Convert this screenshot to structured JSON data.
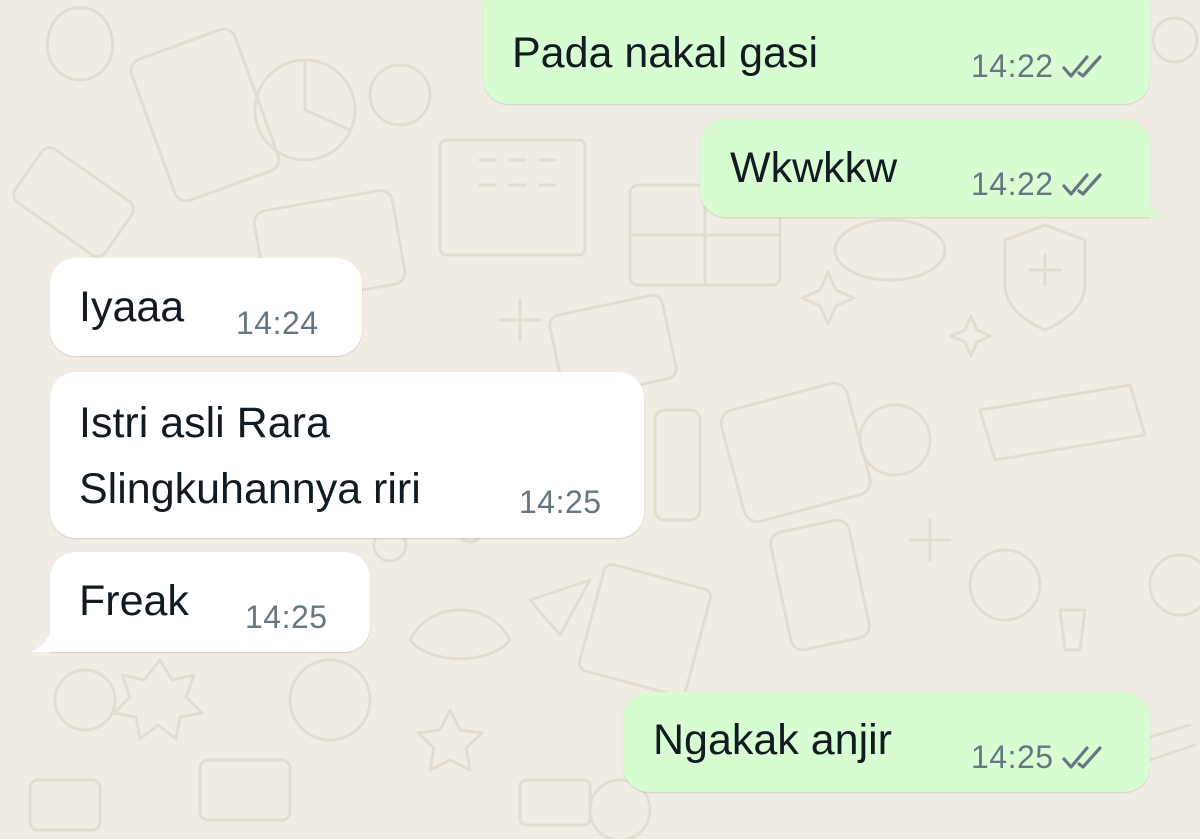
{
  "messages": [
    {
      "direction": "outgoing",
      "text": "Pada nakal gasi",
      "time": "14:22",
      "status": "read"
    },
    {
      "direction": "outgoing",
      "text": "Wkwkkw",
      "time": "14:22",
      "status": "read"
    },
    {
      "direction": "incoming",
      "text": "Iyaaa",
      "time": "14:24"
    },
    {
      "direction": "incoming",
      "lines": [
        "Istri asli Rara",
        "Slingkuhannya riri"
      ],
      "time": "14:25"
    },
    {
      "direction": "incoming",
      "text": "Freak",
      "time": "14:25"
    },
    {
      "direction": "outgoing",
      "text": "Ngakak anjir",
      "time": "14:25",
      "status": "read"
    }
  ],
  "icons": {
    "read_receipt": "double-check-icon"
  },
  "colors": {
    "wallpaper": "#f1ede5",
    "outgoing_bubble": "#d9fdd3",
    "incoming_bubble": "#ffffff",
    "meta_text": "#667781"
  }
}
